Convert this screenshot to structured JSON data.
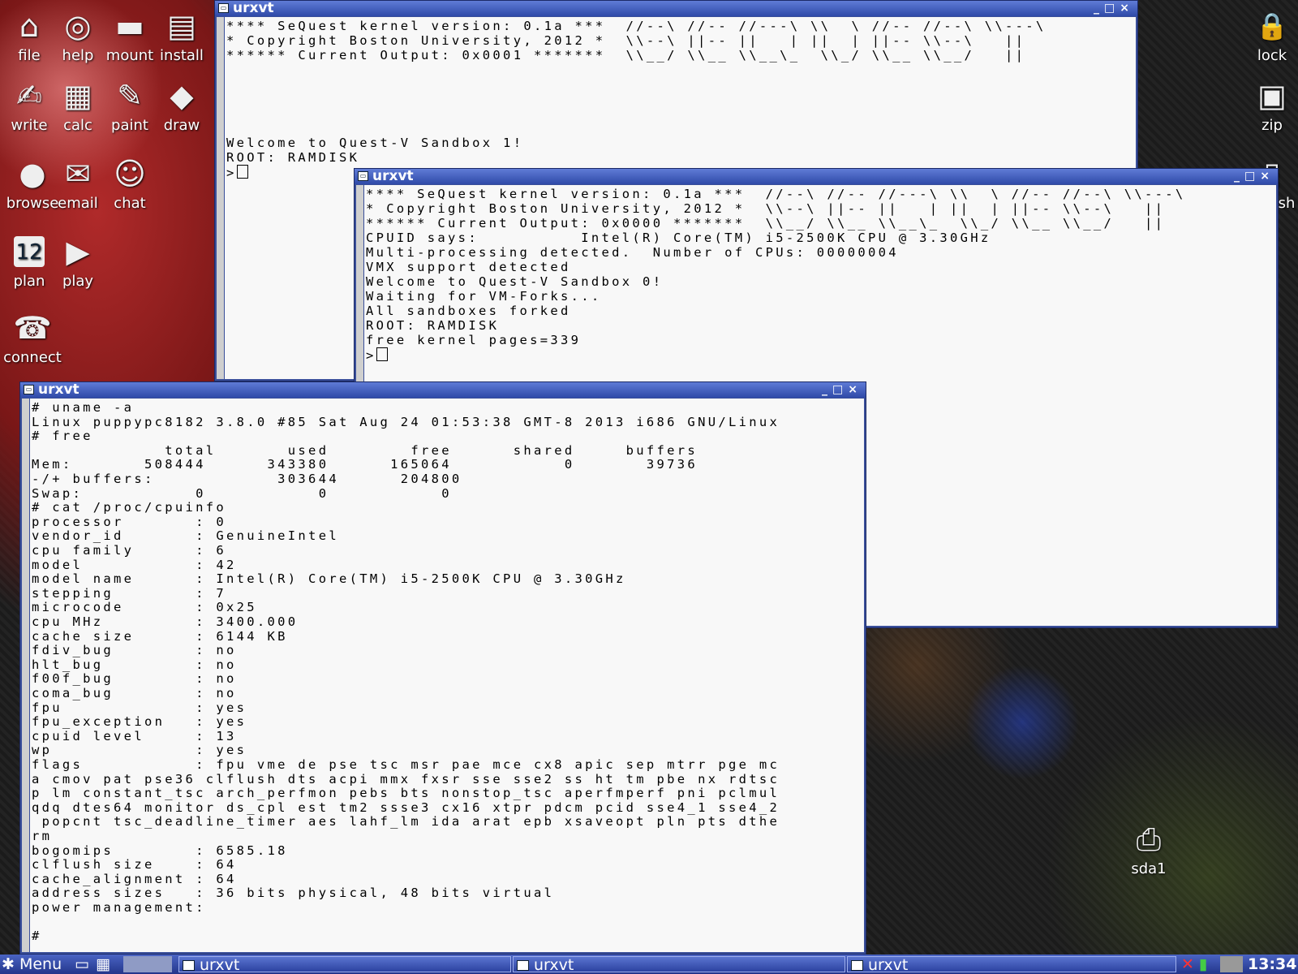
{
  "desktop_icons": [
    {
      "label": "file",
      "icon": "home-icon",
      "glyph": "⌂"
    },
    {
      "label": "help",
      "icon": "lifebuoy-icon",
      "glyph": "◎"
    },
    {
      "label": "mount",
      "icon": "drive-icon",
      "glyph": "▬"
    },
    {
      "label": "install",
      "icon": "package-icon",
      "glyph": "▤"
    },
    {
      "label": "write",
      "icon": "write-icon",
      "glyph": "✍"
    },
    {
      "label": "calc",
      "icon": "calculator-icon",
      "glyph": "▦"
    },
    {
      "label": "paint",
      "icon": "palette-icon",
      "glyph": "✎"
    },
    {
      "label": "draw",
      "icon": "draw-icon",
      "glyph": "◆"
    },
    {
      "label": "browse",
      "icon": "globe-icon",
      "glyph": "●"
    },
    {
      "label": "email",
      "icon": "envelope-icon",
      "glyph": "✉"
    },
    {
      "label": "chat",
      "icon": "people-icon",
      "glyph": "☺"
    },
    {
      "label": "plan",
      "icon": "calendar-icon",
      "glyph": "12"
    },
    {
      "label": "play",
      "icon": "clapper-icon",
      "glyph": "▶"
    },
    {
      "label": "connect",
      "icon": "connect-icon",
      "glyph": "☎"
    },
    {
      "label": "lock",
      "icon": "padlock-icon",
      "glyph": "🔒"
    },
    {
      "label": "zip",
      "icon": "archive-icon",
      "glyph": "▣"
    },
    {
      "label": "sh",
      "icon": "trash-icon",
      "glyph": "▯"
    },
    {
      "label": "sda1",
      "icon": "printer-drive-icon",
      "glyph": "⎙"
    }
  ],
  "windows": {
    "sandbox1": {
      "title": "urxvt",
      "lines": [
        "**** SeQuest kernel version: 0.1a ***  //--\\ //-- //---\\ \\\\  \\ //-- //--\\ \\\\---\\",
        "* Copyright Boston University, 2012 *  \\\\--\\ ||-- ||   | ||  | ||-- \\\\--\\   ||",
        "****** Current Output: 0x0001 *******  \\\\__/ \\\\__ \\\\__\\_  \\\\_/ \\\\__ \\\\__/   ||",
        "",
        "",
        "",
        "",
        "",
        "Welcome to Quest-V Sandbox 1!",
        "ROOT: RAMDISK",
        ">"
      ]
    },
    "sandbox0": {
      "title": "urxvt",
      "lines": [
        "**** SeQuest kernel version: 0.1a ***  //--\\ //-- //---\\ \\\\  \\ //-- //--\\ \\\\---\\",
        "* Copyright Boston University, 2012 *  \\\\--\\ ||-- ||   | ||  | ||-- \\\\--\\   ||",
        "****** Current Output: 0x0000 *******  \\\\__/ \\\\__ \\\\__\\_  \\\\_/ \\\\__ \\\\__/   ||",
        "CPUID says:          Intel(R) Core(TM) i5-2500K CPU @ 3.30GHz",
        "Multi-processing detected.  Number of CPUs: 00000004",
        "VMX support detected",
        "Welcome to Quest-V Sandbox 0!",
        "Waiting for VM-Forks...",
        "All sandboxes forked",
        "ROOT: RAMDISK",
        "free kernel pages=339",
        ">"
      ]
    },
    "linux": {
      "title": "urxvt",
      "lines": [
        "# uname -a",
        "Linux puppypc8182 3.8.0 #85 Sat Aug 24 01:53:38 GMT-8 2013 i686 GNU/Linux",
        "# free",
        "             total       used        free      shared     buffers",
        "Mem:       508444      343380      165064           0       39736",
        "-/+ buffers:            303644      204800",
        "Swap:           0           0           0",
        "# cat /proc/cpuinfo",
        "processor       : 0",
        "vendor_id       : GenuineIntel",
        "cpu family      : 6",
        "model           : 42",
        "model name      : Intel(R) Core(TM) i5-2500K CPU @ 3.30GHz",
        "stepping        : 7",
        "microcode       : 0x25",
        "cpu MHz         : 3400.000",
        "cache size      : 6144 KB",
        "fdiv_bug        : no",
        "hlt_bug         : no",
        "f00f_bug        : no",
        "coma_bug        : no",
        "fpu             : yes",
        "fpu_exception   : yes",
        "cpuid level     : 13",
        "wp              : yes",
        "flags           : fpu vme de pse tsc msr pae mce cx8 apic sep mtrr pge mc",
        "a cmov pat pse36 clflush dts acpi mmx fxsr sse sse2 ss ht tm pbe nx rdtsc",
        "p lm constant_tsc arch_perfmon pebs bts nonstop_tsc aperfmperf pni pclmul",
        "qdq dtes64 monitor ds_cpl est tm2 ssse3 cx16 xtpr pdcm pcid sse4_1 sse4_2",
        " popcnt tsc_deadline_timer aes lahf_lm ida arat epb xsaveopt pln pts dthe",
        "rm",
        "bogomips        : 6585.18",
        "clflush size    : 64",
        "cache_alignment : 64",
        "address sizes   : 36 bits physical, 48 bits virtual",
        "power management:",
        "",
        "#"
      ]
    }
  },
  "taskbar": {
    "menu_label": "Menu",
    "tasks": [
      "urxvt",
      "urxvt",
      "urxvt"
    ],
    "clock": "13:34"
  }
}
